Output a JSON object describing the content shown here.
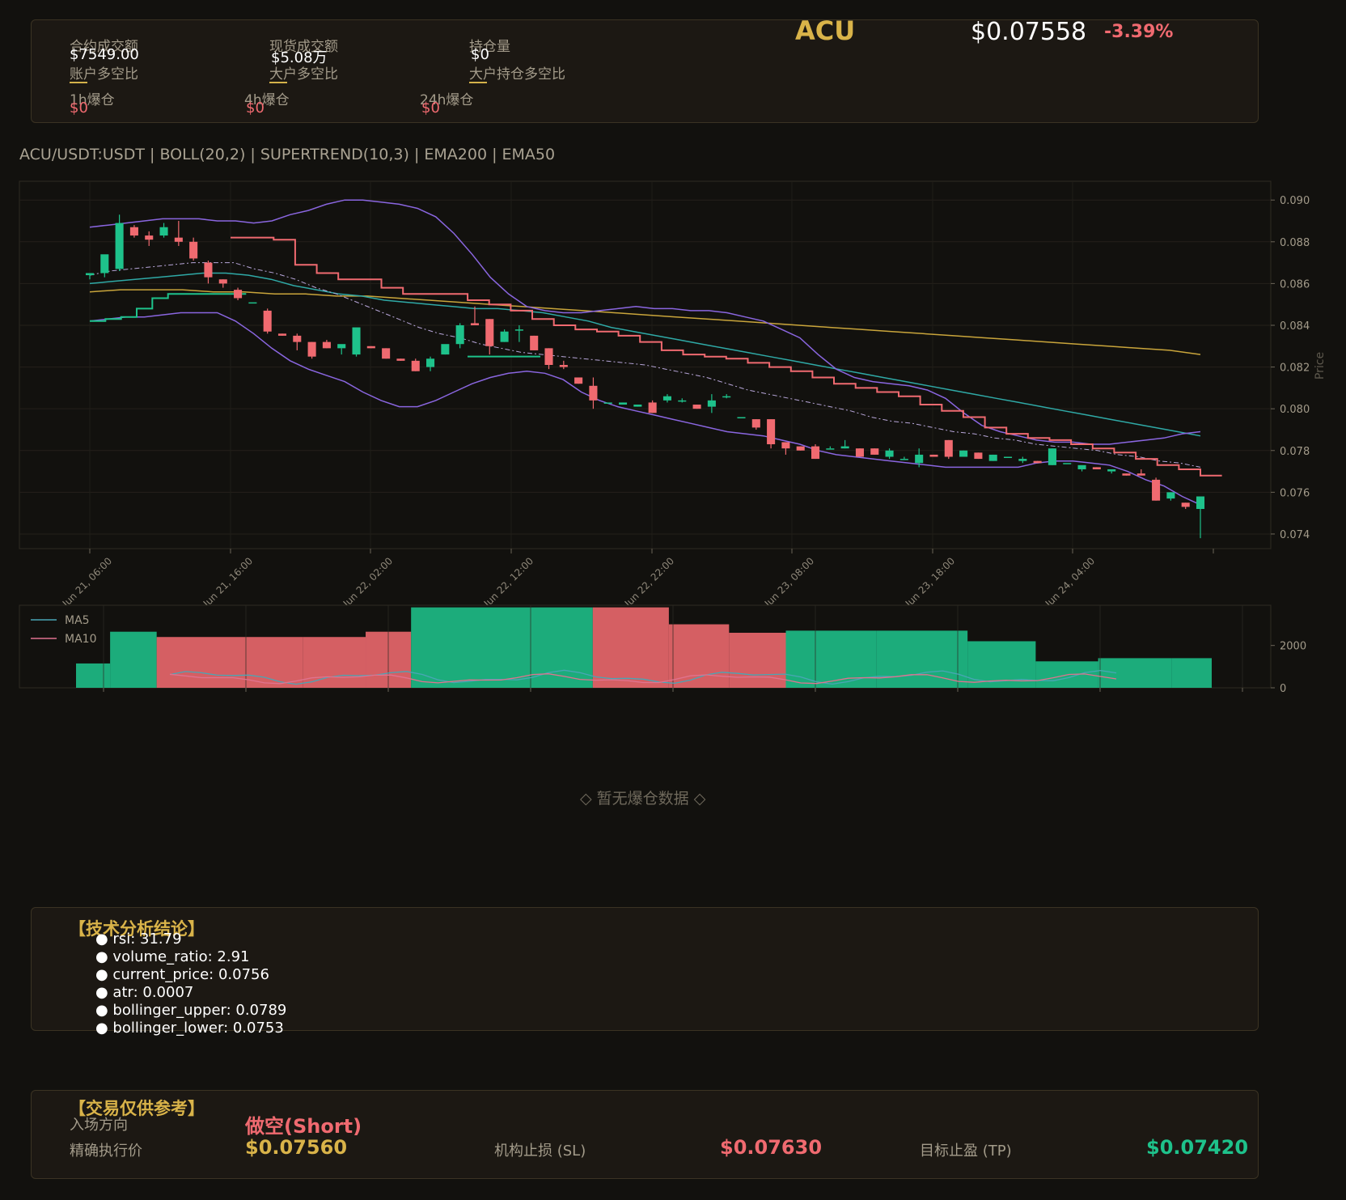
{
  "header": {
    "symbol": "ACU",
    "price": "$0.07558",
    "change": "-3.39%",
    "stats": [
      {
        "label": "合约成交额",
        "value": "$7549.00"
      },
      {
        "label": "现货成交额",
        "value": "$5.08万"
      },
      {
        "label": "持仓量",
        "value": "$0"
      }
    ],
    "ratios": [
      "账户多空比",
      "大户多空比",
      "大户持仓多空比"
    ],
    "liquidations": [
      {
        "label": "1h爆仓",
        "value": "$0"
      },
      {
        "label": "4h爆仓",
        "value": "$0"
      },
      {
        "label": "24h爆仓",
        "value": "$0"
      }
    ]
  },
  "chart_title": "ACU/USDT:USDT | BOLL(20,2) | SUPERTREND(10,3) | EMA200 | EMA50",
  "chart_data": {
    "type": "candlestick",
    "ylabel": "Price",
    "ylim": [
      0.0733,
      0.0909
    ],
    "yticks": [
      "0.090",
      "0.088",
      "0.086",
      "0.084",
      "0.082",
      "0.080",
      "0.078",
      "0.076",
      "0.074"
    ],
    "xticks": [
      "Jun 21, 06:00",
      "Jun 21, 16:00",
      "Jun 22, 02:00",
      "Jun 22, 12:00",
      "Jun 22, 22:00",
      "Jun 23, 08:00",
      "Jun 23, 18:00",
      "Jun 24, 04:00"
    ],
    "candles": [
      [
        0.0864,
        0.0865,
        0.0862,
        0.0865
      ],
      [
        0.0865,
        0.0868,
        0.0863,
        0.0874
      ],
      [
        0.0867,
        0.0893,
        0.0866,
        0.0889
      ],
      [
        0.0887,
        0.0888,
        0.0882,
        0.0883
      ],
      [
        0.0883,
        0.0885,
        0.0878,
        0.0881
      ],
      [
        0.0883,
        0.0889,
        0.0882,
        0.0887
      ],
      [
        0.0882,
        0.089,
        0.0878,
        0.088
      ],
      [
        0.088,
        0.0882,
        0.0871,
        0.0872
      ],
      [
        0.087,
        0.0871,
        0.086,
        0.0863
      ],
      [
        0.0862,
        0.0862,
        0.0858,
        0.086
      ],
      [
        0.0857,
        0.0858,
        0.0852,
        0.0853
      ],
      [
        0.0851,
        0.0851,
        0.0851,
        0.0851
      ],
      [
        0.0847,
        0.0848,
        0.0836,
        0.0837
      ],
      [
        0.0836,
        0.0836,
        0.0835,
        0.0835
      ],
      [
        0.0835,
        0.0836,
        0.0828,
        0.0832
      ],
      [
        0.0832,
        0.0832,
        0.0824,
        0.0825
      ],
      [
        0.0832,
        0.0833,
        0.0829,
        0.0829
      ],
      [
        0.0829,
        0.0829,
        0.0826,
        0.0831
      ],
      [
        0.0826,
        0.0838,
        0.0825,
        0.0839
      ],
      [
        0.083,
        0.083,
        0.0829,
        0.0829
      ],
      [
        0.0829,
        0.0829,
        0.0824,
        0.0824
      ],
      [
        0.0824,
        0.0824,
        0.0823,
        0.0823
      ],
      [
        0.0823,
        0.0824,
        0.0818,
        0.0818
      ],
      [
        0.082,
        0.0825,
        0.0818,
        0.0824
      ],
      [
        0.0826,
        0.0827,
        0.0826,
        0.0831
      ],
      [
        0.0831,
        0.0841,
        0.0829,
        0.084
      ],
      [
        0.0841,
        0.0849,
        0.084,
        0.084
      ],
      [
        0.0843,
        0.0843,
        0.0826,
        0.083
      ],
      [
        0.0832,
        0.0838,
        0.0832,
        0.0837
      ],
      [
        0.0838,
        0.084,
        0.0832,
        0.0838
      ],
      [
        0.0835,
        0.0835,
        0.0828,
        0.0828
      ],
      [
        0.0829,
        0.0829,
        0.0819,
        0.0821
      ],
      [
        0.0821,
        0.0823,
        0.0819,
        0.082
      ],
      [
        0.0815,
        0.0815,
        0.0812,
        0.0812
      ],
      [
        0.0811,
        0.0815,
        0.08,
        0.0804
      ],
      [
        0.0803,
        0.0803,
        0.0803,
        0.0803
      ],
      [
        0.0802,
        0.0803,
        0.0802,
        0.0803
      ],
      [
        0.0801,
        0.0802,
        0.0801,
        0.0802
      ],
      [
        0.0803,
        0.0804,
        0.0798,
        0.0798
      ],
      [
        0.0804,
        0.0807,
        0.0803,
        0.0806
      ],
      [
        0.0804,
        0.0805,
        0.0803,
        0.0804
      ],
      [
        0.0802,
        0.0802,
        0.08,
        0.08
      ],
      [
        0.0801,
        0.0807,
        0.0798,
        0.0804
      ],
      [
        0.0806,
        0.0807,
        0.0805,
        0.0806
      ],
      [
        0.0796,
        0.0796,
        0.0796,
        0.0796
      ],
      [
        0.0795,
        0.0795,
        0.079,
        0.0791
      ],
      [
        0.0795,
        0.0795,
        0.0781,
        0.0783
      ],
      [
        0.0784,
        0.0784,
        0.0778,
        0.0781
      ],
      [
        0.0782,
        0.0782,
        0.078,
        0.078
      ],
      [
        0.0782,
        0.0783,
        0.0776,
        0.0776
      ],
      [
        0.0781,
        0.0782,
        0.0781,
        0.0781
      ],
      [
        0.0781,
        0.0785,
        0.0781,
        0.0782
      ],
      [
        0.0781,
        0.0781,
        0.0777,
        0.0777
      ],
      [
        0.0781,
        0.0781,
        0.0778,
        0.0778
      ],
      [
        0.0777,
        0.0781,
        0.0776,
        0.078
      ],
      [
        0.0776,
        0.0777,
        0.0776,
        0.0776
      ],
      [
        0.0774,
        0.0781,
        0.0772,
        0.0778
      ],
      [
        0.0778,
        0.0778,
        0.0777,
        0.0777
      ],
      [
        0.0785,
        0.0785,
        0.0776,
        0.0777
      ],
      [
        0.0777,
        0.078,
        0.0777,
        0.078
      ],
      [
        0.0779,
        0.0779,
        0.0776,
        0.0776
      ],
      [
        0.0775,
        0.0778,
        0.0775,
        0.0778
      ],
      [
        0.0777,
        0.0777,
        0.0777,
        0.0777
      ],
      [
        0.0775,
        0.0777,
        0.0774,
        0.0776
      ],
      [
        0.0775,
        0.0775,
        0.0774,
        0.0774
      ],
      [
        0.0773,
        0.0781,
        0.0773,
        0.0781
      ],
      [
        0.0774,
        0.0774,
        0.0774,
        0.0774
      ],
      [
        0.0771,
        0.0771,
        0.077,
        0.0773
      ],
      [
        0.0772,
        0.0772,
        0.0771,
        0.0771
      ],
      [
        0.077,
        0.077,
        0.0769,
        0.0771
      ],
      [
        0.0769,
        0.0769,
        0.0768,
        0.0768
      ],
      [
        0.0769,
        0.0771,
        0.0768,
        0.0768
      ],
      [
        0.0766,
        0.0767,
        0.0756,
        0.0756
      ],
      [
        0.0757,
        0.076,
        0.0756,
        0.076
      ],
      [
        0.0755,
        0.0755,
        0.0752,
        0.0753
      ],
      [
        0.0752,
        0.0756,
        0.0738,
        0.0758
      ]
    ],
    "boll_upper": [
      0.0887,
      0.0888,
      0.0889,
      0.089,
      0.0891,
      0.0891,
      0.0891,
      0.089,
      0.089,
      0.0889,
      0.089,
      0.0893,
      0.0895,
      0.0898,
      0.09,
      0.09,
      0.0899,
      0.0898,
      0.0896,
      0.0892,
      0.0884,
      0.0874,
      0.0863,
      0.0855,
      0.0849,
      0.0847,
      0.0846,
      0.0846,
      0.0847,
      0.0848,
      0.0849,
      0.0848,
      0.0848,
      0.0847,
      0.0847,
      0.0846,
      0.0844,
      0.0842,
      0.0838,
      0.0834,
      0.0826,
      0.0819,
      0.0815,
      0.0813,
      0.0812,
      0.0811,
      0.0809,
      0.0805,
      0.0798,
      0.0792,
      0.0789,
      0.0787,
      0.0785,
      0.0784,
      0.0784,
      0.0783,
      0.0783,
      0.0784,
      0.0785,
      0.0786,
      0.0788,
      0.0789
    ],
    "boll_mid": [
      0.0864,
      0.0866,
      0.0867,
      0.0868,
      0.0869,
      0.087,
      0.087,
      0.087,
      0.0867,
      0.0865,
      0.0862,
      0.0858,
      0.0855,
      0.0851,
      0.0847,
      0.0843,
      0.0839,
      0.0836,
      0.0834,
      0.0831,
      0.0829,
      0.0827,
      0.0826,
      0.0825,
      0.0824,
      0.0823,
      0.0822,
      0.0821,
      0.0819,
      0.0817,
      0.0815,
      0.0812,
      0.0809,
      0.0807,
      0.0805,
      0.0803,
      0.0801,
      0.0799,
      0.0796,
      0.0794,
      0.0793,
      0.0791,
      0.0789,
      0.0788,
      0.0786,
      0.0785,
      0.0783,
      0.0782,
      0.0781,
      0.078,
      0.0778,
      0.0777,
      0.0775,
      0.0774,
      0.0772
    ],
    "boll_lower": [
      0.0842,
      0.0843,
      0.0844,
      0.0844,
      0.0845,
      0.0846,
      0.0846,
      0.0846,
      0.0842,
      0.0836,
      0.0829,
      0.0823,
      0.0819,
      0.0816,
      0.0813,
      0.0808,
      0.0804,
      0.0801,
      0.0801,
      0.0804,
      0.0808,
      0.0812,
      0.0815,
      0.0817,
      0.0818,
      0.0817,
      0.0814,
      0.0808,
      0.0804,
      0.0801,
      0.0799,
      0.0797,
      0.0795,
      0.0793,
      0.0791,
      0.0789,
      0.0788,
      0.0787,
      0.0785,
      0.0783,
      0.078,
      0.0778,
      0.0777,
      0.0776,
      0.0775,
      0.0774,
      0.0773,
      0.0772,
      0.0772,
      0.0772,
      0.0772,
      0.0772,
      0.0774,
      0.0775,
      0.0775,
      0.0774,
      0.0773,
      0.077,
      0.0766,
      0.0763,
      0.0758,
      0.0754
    ],
    "ema50": [
      0.086,
      0.0861,
      0.0862,
      0.0863,
      0.0864,
      0.0865,
      0.0865,
      0.0864,
      0.0862,
      0.0859,
      0.0857,
      0.0855,
      0.0854,
      0.0852,
      0.0851,
      0.085,
      0.0849,
      0.0848,
      0.0848,
      0.0847,
      0.0846,
      0.0844,
      0.0842,
      0.0839,
      0.0837,
      0.0835,
      0.0833,
      0.0831,
      0.0829,
      0.0827,
      0.0825,
      0.0823,
      0.0821,
      0.0819,
      0.0817,
      0.0815,
      0.0813,
      0.0811,
      0.0809,
      0.0807,
      0.0805,
      0.0803,
      0.0801,
      0.0799,
      0.0797,
      0.0795,
      0.0793,
      0.0791,
      0.0789,
      0.0787
    ],
    "ema200": [
      0.0856,
      0.0857,
      0.0857,
      0.0857,
      0.0856,
      0.0856,
      0.0855,
      0.0855,
      0.0854,
      0.0854,
      0.0853,
      0.0852,
      0.0851,
      0.085,
      0.0849,
      0.0848,
      0.0847,
      0.0846,
      0.0845,
      0.0844,
      0.0843,
      0.0842,
      0.0841,
      0.084,
      0.0839,
      0.0838,
      0.0837,
      0.0836,
      0.0835,
      0.0834,
      0.0833,
      0.0832,
      0.0831,
      0.083,
      0.0829,
      0.0828,
      0.0826
    ],
    "supertrend_up": [
      [
        0.0842,
        0.0843,
        0.0844,
        0.0848,
        0.0853,
        0.0855,
        0.0855,
        0.0855,
        0.0855,
        0.0855
      ]
    ],
    "supertrend_down": [
      0.0882,
      0.0882,
      0.0881,
      0.0869,
      0.0865,
      0.0862,
      0.0862,
      0.0858,
      0.0855,
      0.0855,
      0.0855,
      0.0852,
      0.085,
      0.0847,
      0.0843,
      0.084,
      0.0838,
      0.0837,
      0.0835,
      0.0832,
      0.0828,
      0.0826,
      0.0825,
      0.0824,
      0.0822,
      0.082,
      0.0818,
      0.0815,
      0.0812,
      0.081,
      0.0808,
      0.0806,
      0.0802,
      0.0799,
      0.0796,
      0.0791,
      0.0788,
      0.0786,
      0.0785,
      0.0783,
      0.0781,
      0.0779,
      0.0776,
      0.0773,
      0.0771,
      0.0768
    ],
    "volume": {
      "yticks": [
        "2000",
        "0"
      ],
      "ylim": [
        0,
        3900
      ],
      "legend": [
        "MA5",
        "MA10"
      ],
      "bars": [
        {
          "x0": 0.0,
          "x1": 0.03,
          "v": 1150,
          "dir": "up"
        },
        {
          "x0": 0.03,
          "x1": 0.071,
          "v": 2650,
          "dir": "up"
        },
        {
          "x0": 0.071,
          "x1": 0.2,
          "v": 2400,
          "dir": "down"
        },
        {
          "x0": 0.2,
          "x1": 0.255,
          "v": 2400,
          "dir": "down"
        },
        {
          "x0": 0.255,
          "x1": 0.295,
          "v": 2650,
          "dir": "down"
        },
        {
          "x0": 0.295,
          "x1": 0.375,
          "v": 3800,
          "dir": "up"
        },
        {
          "x0": 0.375,
          "x1": 0.455,
          "v": 3800,
          "dir": "up"
        },
        {
          "x0": 0.455,
          "x1": 0.522,
          "v": 3800,
          "dir": "down"
        },
        {
          "x0": 0.522,
          "x1": 0.575,
          "v": 3000,
          "dir": "down"
        },
        {
          "x0": 0.575,
          "x1": 0.625,
          "v": 2600,
          "dir": "down"
        },
        {
          "x0": 0.625,
          "x1": 0.705,
          "v": 2700,
          "dir": "up"
        },
        {
          "x0": 0.705,
          "x1": 0.785,
          "v": 2700,
          "dir": "up"
        },
        {
          "x0": 0.785,
          "x1": 0.845,
          "v": 2200,
          "dir": "up"
        },
        {
          "x0": 0.845,
          "x1": 0.9,
          "v": 1250,
          "dir": "up"
        },
        {
          "x0": 0.9,
          "x1": 0.965,
          "v": 1400,
          "dir": "up"
        },
        {
          "x0": 0.965,
          "x1": 1.0,
          "v": 1400,
          "dir": "up"
        }
      ]
    }
  },
  "liquidation_empty": "◇ 暂无爆仓数据 ◇",
  "analysis": {
    "title": "【技术分析结论】",
    "items": [
      "● rsi: 31.79",
      "● volume_ratio: 2.91",
      "● current_price: 0.0756",
      "● atr: 0.0007",
      "● bollinger_upper: 0.0789",
      "● bollinger_lower: 0.0753"
    ]
  },
  "trade": {
    "title": "【交易仅供参考】",
    "direction_label": "入场方向",
    "direction_value": "做空(Short)",
    "entry_label": "精确执行价",
    "entry_value": "$0.07560",
    "sl_label": "机构止损 (SL)",
    "sl_value": "$0.07630",
    "tp_label": "目标止盈 (TP)",
    "tp_value": "$0.07420"
  },
  "colors": {
    "up": "#1ec28b",
    "down": "#f06a70",
    "boll": "#8a66e0",
    "ema50": "#2fa9a6",
    "ema200": "#c9a53b",
    "gold": "#d9b349"
  }
}
